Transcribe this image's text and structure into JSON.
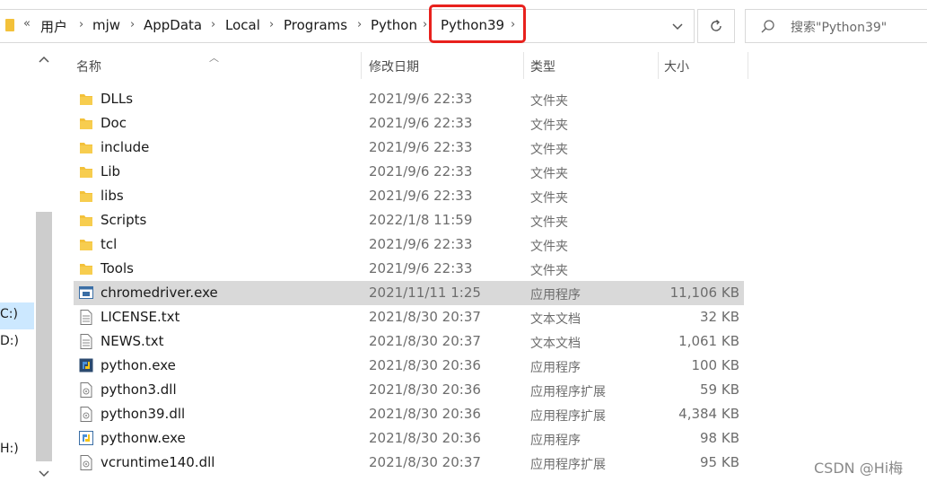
{
  "address_bar": {
    "overflow": "«",
    "crumbs": [
      "用户",
      "mjw",
      "AppData",
      "Local",
      "Programs",
      "Python",
      "Python39"
    ],
    "highlighted_crumb": "Python39"
  },
  "search": {
    "placeholder": "搜索\"Python39\""
  },
  "nav": {
    "drives": [
      "C:)",
      "D:)",
      "H:)"
    ]
  },
  "columns": {
    "name": "名称",
    "date": "修改日期",
    "type": "类型",
    "size": "大小"
  },
  "files": [
    {
      "name": "DLLs",
      "date": "2021/9/6 22:33",
      "type": "文件夹",
      "size": "",
      "icon": "folder-icon"
    },
    {
      "name": "Doc",
      "date": "2021/9/6 22:33",
      "type": "文件夹",
      "size": "",
      "icon": "folder-icon"
    },
    {
      "name": "include",
      "date": "2021/9/6 22:33",
      "type": "文件夹",
      "size": "",
      "icon": "folder-icon"
    },
    {
      "name": "Lib",
      "date": "2021/9/6 22:33",
      "type": "文件夹",
      "size": "",
      "icon": "folder-icon"
    },
    {
      "name": "libs",
      "date": "2021/9/6 22:33",
      "type": "文件夹",
      "size": "",
      "icon": "folder-icon"
    },
    {
      "name": "Scripts",
      "date": "2022/1/8 11:59",
      "type": "文件夹",
      "size": "",
      "icon": "folder-icon"
    },
    {
      "name": "tcl",
      "date": "2021/9/6 22:33",
      "type": "文件夹",
      "size": "",
      "icon": "folder-icon"
    },
    {
      "name": "Tools",
      "date": "2021/9/6 22:33",
      "type": "文件夹",
      "size": "",
      "icon": "folder-icon"
    },
    {
      "name": "chromedriver.exe",
      "date": "2021/11/11 1:25",
      "type": "应用程序",
      "size": "11,106 KB",
      "icon": "exe-icon",
      "selected": true
    },
    {
      "name": "LICENSE.txt",
      "date": "2021/8/30 20:37",
      "type": "文本文档",
      "size": "32 KB",
      "icon": "text-file-icon"
    },
    {
      "name": "NEWS.txt",
      "date": "2021/8/30 20:37",
      "type": "文本文档",
      "size": "1,061 KB",
      "icon": "text-file-icon"
    },
    {
      "name": "python.exe",
      "date": "2021/8/30 20:36",
      "type": "应用程序",
      "size": "100 KB",
      "icon": "python-icon"
    },
    {
      "name": "python3.dll",
      "date": "2021/8/30 20:36",
      "type": "应用程序扩展",
      "size": "59 KB",
      "icon": "dll-icon"
    },
    {
      "name": "python39.dll",
      "date": "2021/8/30 20:36",
      "type": "应用程序扩展",
      "size": "4,384 KB",
      "icon": "dll-icon"
    },
    {
      "name": "pythonw.exe",
      "date": "2021/8/30 20:36",
      "type": "应用程序",
      "size": "98 KB",
      "icon": "pythonw-icon"
    },
    {
      "name": "vcruntime140.dll",
      "date": "2021/8/30 20:37",
      "type": "应用程序扩展",
      "size": "95 KB",
      "icon": "dll-icon"
    }
  ],
  "watermark": "CSDN @Hi梅",
  "colors": {
    "highlight_border": "#e8211d",
    "folder": "#f3c13a",
    "selected_row": "#d9d9d9"
  }
}
